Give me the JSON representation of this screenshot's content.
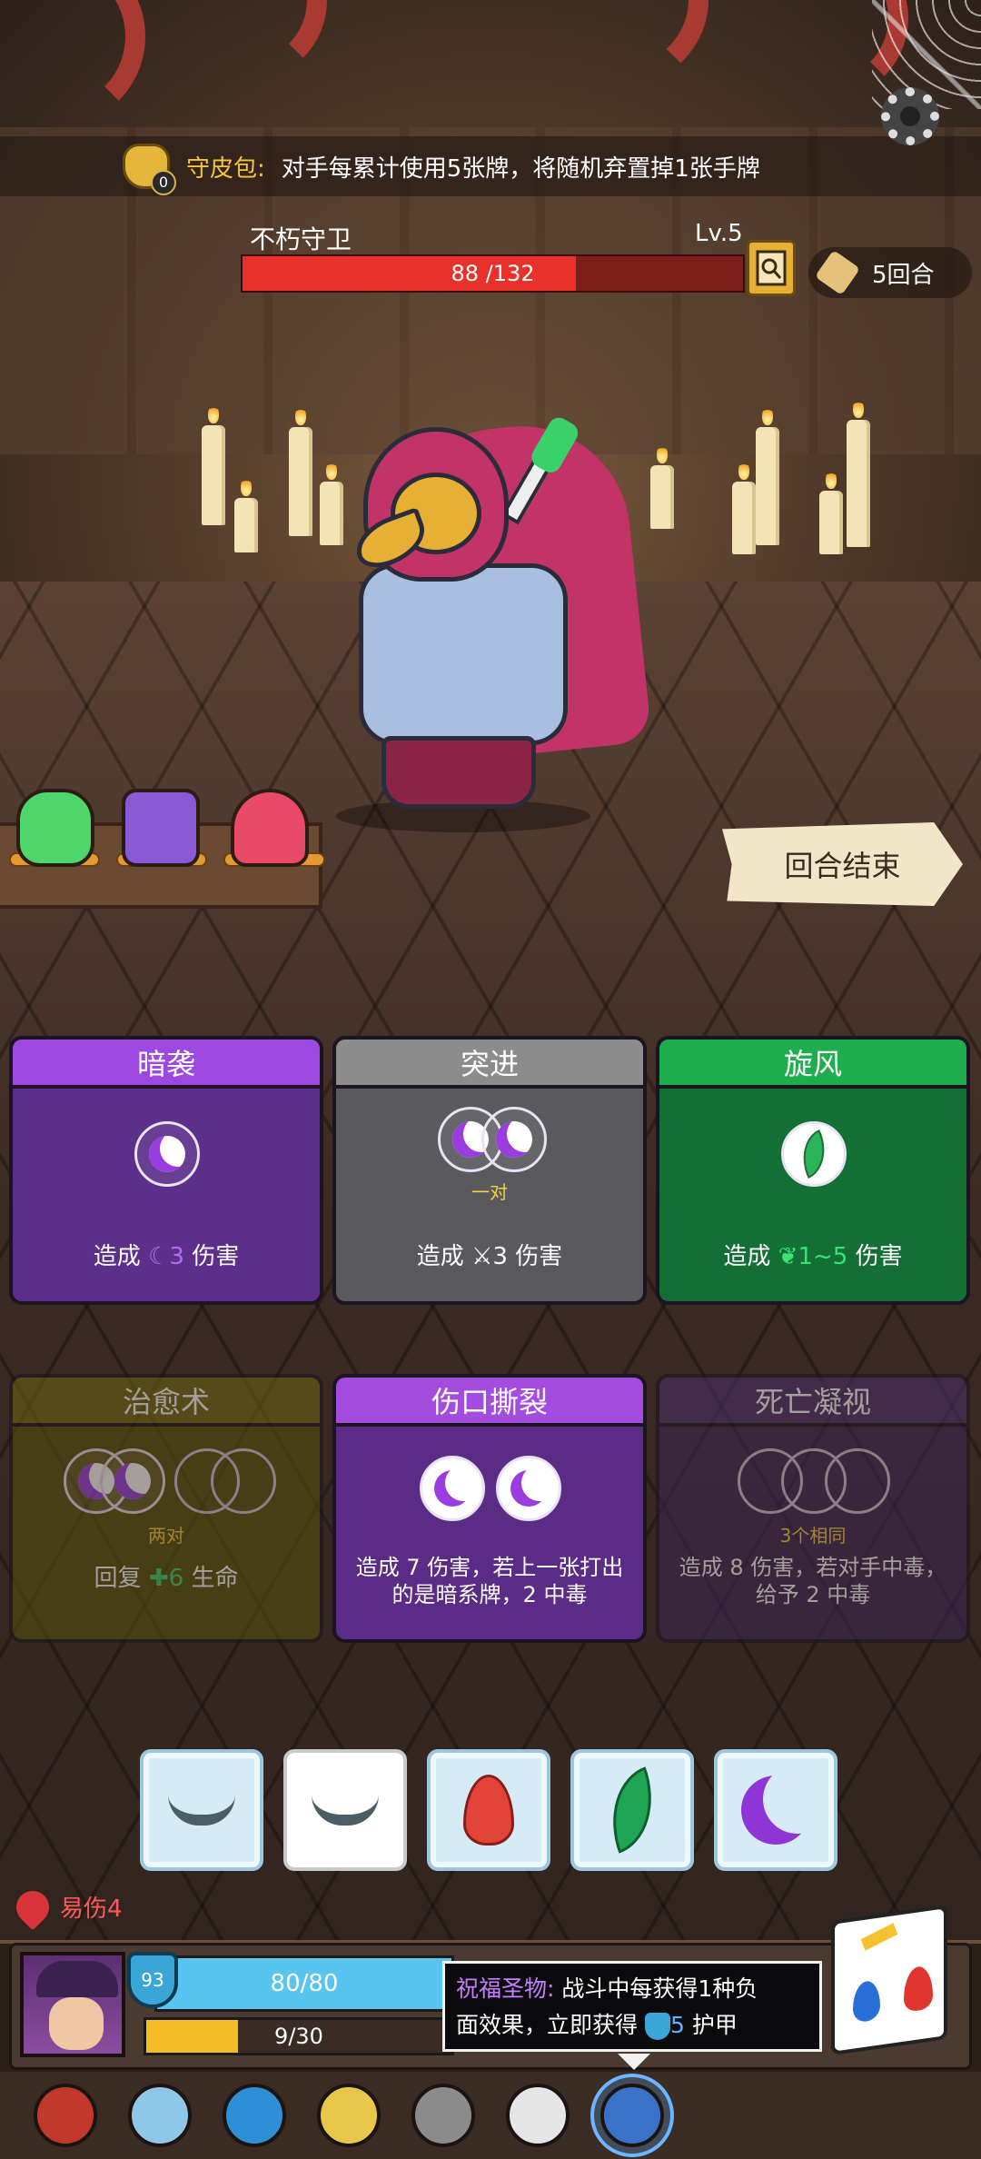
{
  "top_banner": {
    "item_icon": "money-bag-icon",
    "item_count": "0",
    "item_name": "守皮包:",
    "item_desc": "对手每累计使用5张牌，将随机弃置掉1张手牌"
  },
  "settings_icon": "gear-icon",
  "enemy": {
    "name": "不朽守卫",
    "level": "Lv.5",
    "hp_text": "88 /132",
    "hp_current": 88,
    "hp_max": 132
  },
  "inspect_icon": "magnifier-icon",
  "round": {
    "icon": "scroll-icon",
    "text": "5回合"
  },
  "potions": [
    {
      "name": "green-potion-icon",
      "color": "#4fd66b"
    },
    {
      "name": "purple-potion-icon",
      "color": "#8a5ad6"
    },
    {
      "name": "red-potion-icon",
      "color": "#e84a67"
    }
  ],
  "end_turn_label": "回合结束",
  "cards": [
    {
      "title": "暗袭",
      "requirement": "",
      "desc_prefix": "造成",
      "desc_value": "3",
      "desc_suffix": "伤害",
      "color_title": "#9d49e0",
      "color_body": "#5b2f8a"
    },
    {
      "title": "突进",
      "requirement": "一对",
      "desc_prefix": "造成",
      "desc_value": "3",
      "desc_suffix": "伤害",
      "color_title": "#8c8c8c",
      "color_body": "#5a5a5e"
    },
    {
      "title": "旋风",
      "requirement": "",
      "desc_prefix": "造成",
      "desc_value": "1~5",
      "desc_suffix": "伤害",
      "color_title": "#1fae4e",
      "color_body": "#136f33"
    },
    {
      "title": "治愈术",
      "requirement": "两对",
      "desc_prefix": "回复",
      "desc_value": "6",
      "desc_suffix": "生命",
      "color_title": "#6e6511",
      "color_body": "#56500e"
    },
    {
      "title": "伤口撕裂",
      "requirement": "",
      "desc": "造成 7 伤害，若上一张打出的是暗系牌，2 中毒",
      "color_title": "#a44ce0",
      "color_body": "#5a2c86"
    },
    {
      "title": "死亡凝视",
      "requirement": "3个相同",
      "desc": "造成 8 伤害，若对手中毒，给予 2 中毒",
      "color_title": "#4a2f6b",
      "color_body": "#3b2654"
    }
  ],
  "dice": [
    {
      "face": "closed-eye-icon",
      "frozen": true
    },
    {
      "face": "closed-eye-icon",
      "frozen": false
    },
    {
      "face": "fire-icon",
      "frozen": true
    },
    {
      "face": "leaf-icon",
      "frozen": true
    },
    {
      "face": "moon-icon",
      "frozen": true
    }
  ],
  "status": {
    "icon": "vulnerable-icon",
    "text": "易伤4"
  },
  "player": {
    "armor": "93",
    "hp_text": "80/80",
    "hp_current": 80,
    "hp_max": 80,
    "energy_text": "9/30",
    "energy_current": 9,
    "energy_max": 30
  },
  "tooltip": {
    "title": "祝福圣物:",
    "line1": "战斗中每获得1种负",
    "line2_prefix": "面效果，立即获得",
    "line2_value": "5",
    "line2_suffix": "护甲"
  },
  "relics": [
    {
      "name": "hood-relic-icon",
      "color": "#c0392b"
    },
    {
      "name": "ring-relic-icon",
      "color": "#8fc7e8"
    },
    {
      "name": "water-drop-relic-icon",
      "color": "#2f8fd6"
    },
    {
      "name": "lantern-relic-icon",
      "color": "#e8c64a"
    },
    {
      "name": "stone-egg-relic-icon",
      "color": "#8b8b8b"
    },
    {
      "name": "skull-relic-icon",
      "color": "#e6e6e6"
    },
    {
      "name": "blessing-relic-icon",
      "color": "#3b73c9"
    }
  ]
}
